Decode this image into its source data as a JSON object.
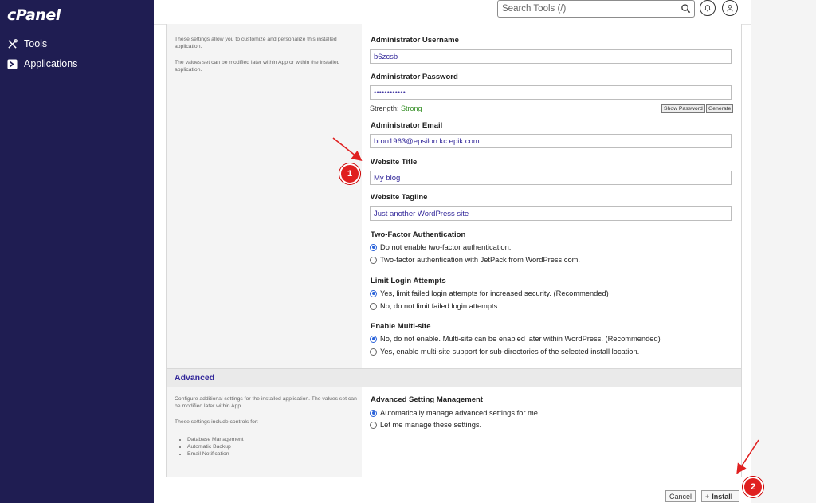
{
  "sidebar": {
    "logo": "cPanel",
    "items": [
      {
        "label": "Tools",
        "icon": "tools-icon"
      },
      {
        "label": "Applications",
        "icon": "applications-icon"
      }
    ]
  },
  "topbar": {
    "search_placeholder": "Search Tools (/)"
  },
  "settings": {
    "desc_1": "These settings allow you to customize and personalize this installed application.",
    "desc_2": "The values set can be modified later within App or within the installed application.",
    "admin_username_label": "Administrator Username",
    "admin_username_value": "b6zcsb",
    "admin_password_label": "Administrator Password",
    "admin_password_value": "••••••••••••",
    "strength_label": "Strength:",
    "strength_value": "Strong",
    "show_password": "Show Password",
    "generate": "Generate",
    "admin_email_label": "Administrator Email",
    "admin_email_value": "bron1963@epsilon.kc.epik.com",
    "website_title_label": "Website Title",
    "website_title_value": "My blog",
    "website_tagline_label": "Website Tagline",
    "website_tagline_value": "Just another WordPress site",
    "twofa_label": "Two-Factor Authentication",
    "twofa_opt1": "Do not enable two-factor authentication.",
    "twofa_opt2": "Two-factor authentication with JetPack from WordPress.com.",
    "limit_label": "Limit Login Attempts",
    "limit_opt1": "Yes, limit failed login attempts for increased security. (Recommended)",
    "limit_opt2": "No, do not limit failed login attempts.",
    "multisite_label": "Enable Multi-site",
    "multisite_opt1": "No, do not enable. Multi-site can be enabled later within WordPress. (Recommended)",
    "multisite_opt2": "Yes, enable multi-site support for sub-directories of the selected install location."
  },
  "advanced": {
    "title": "Advanced",
    "desc_1": "Configure additional settings for the installed application. The values set can be modified later within App.",
    "desc_2": "These settings include controls for:",
    "list": [
      "Database Management",
      "Automatic Backup",
      "Email Notification"
    ],
    "mgmt_label": "Advanced Setting Management",
    "mgmt_opt1": "Automatically manage advanced settings for me.",
    "mgmt_opt2": "Let me manage these settings."
  },
  "footer": {
    "cancel": "Cancel",
    "install": "Install"
  },
  "annotations": {
    "marker_1": "1",
    "marker_2": "2",
    "color": "#e02020"
  }
}
